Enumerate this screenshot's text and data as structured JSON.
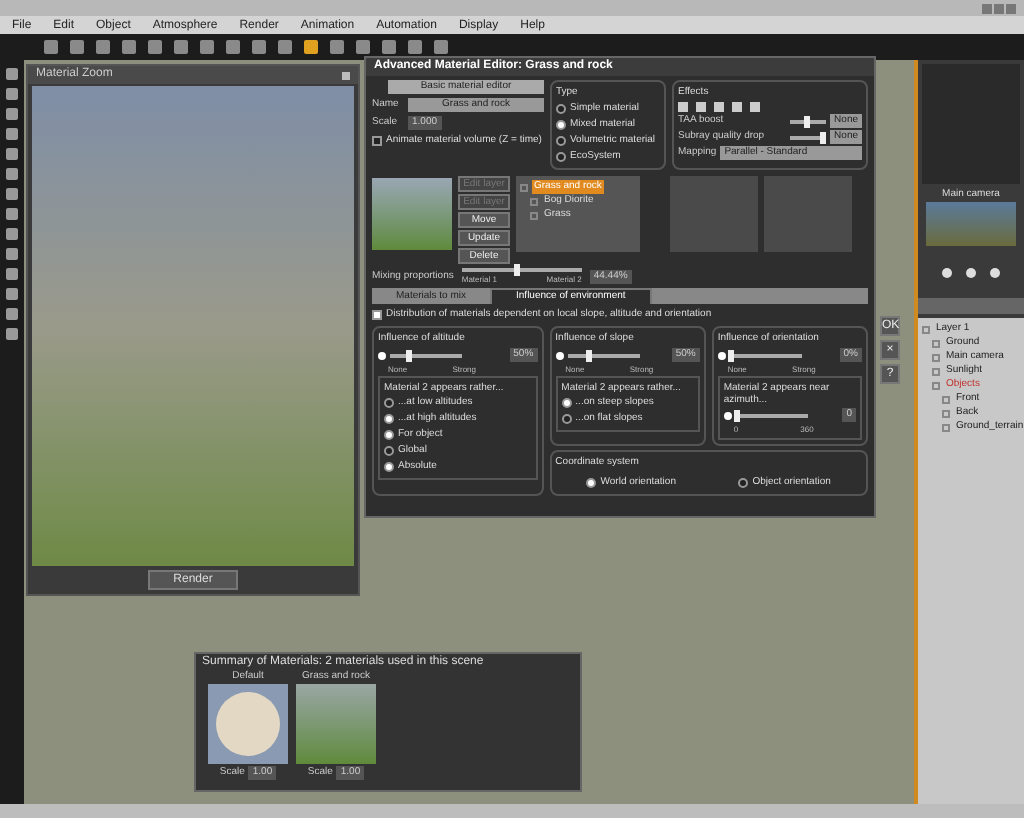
{
  "menu": [
    "File",
    "Edit",
    "Object",
    "Atmosphere",
    "Render",
    "Animation",
    "Automation",
    "Display",
    "Help"
  ],
  "material_zoom": {
    "title": "Material Zoom",
    "render_button": "Render"
  },
  "editor": {
    "title": "Advanced Material Editor: Grass and rock",
    "basic_button": "Basic material editor",
    "name_label": "Name",
    "name": "Grass and rock",
    "scale_label": "Scale",
    "scale": "1.000",
    "animate": {
      "label": "Animate material volume (Z = time)",
      "checked": false
    },
    "type": {
      "title": "Type",
      "options": [
        {
          "label": "Simple material",
          "selected": false
        },
        {
          "label": "Mixed material",
          "selected": true
        },
        {
          "label": "Volumetric material",
          "selected": false
        },
        {
          "label": "EcoSystem",
          "selected": false
        }
      ]
    },
    "effects": {
      "title": "Effects",
      "rows": [
        {
          "label": "TAA boost",
          "level": 0.45,
          "button": "None"
        },
        {
          "label": "Subray quality drop",
          "level": 0.9,
          "button": "None"
        }
      ],
      "mapping_label": "Mapping",
      "mapping": "Parallel - Standard"
    },
    "layer_buttons": [
      {
        "label": "Edit layer",
        "disabled": true
      },
      {
        "label": "Edit layer",
        "disabled": true
      },
      {
        "label": "Move",
        "disabled": false
      },
      {
        "label": "Update",
        "disabled": false
      },
      {
        "label": "Delete",
        "disabled": false
      }
    ],
    "layers": [
      {
        "label": "Grass and rock",
        "selected": true,
        "children": [
          {
            "label": "Bog Diorite",
            "selected": false
          },
          {
            "label": "Grass",
            "selected": false
          }
        ]
      }
    ],
    "mixing": {
      "label": "Mixing proportions",
      "level": 0.45,
      "left": "Material 1",
      "right": "Material 2",
      "value": "44.44%"
    },
    "tabs": [
      {
        "label": "Materials to mix",
        "selected": false
      },
      {
        "label": "Influence of environment",
        "selected": true
      }
    ],
    "distribution": {
      "label": "Distribution of materials dependent on local slope, altitude and orientation",
      "checked": true
    },
    "altitude": {
      "title": "Influence of altitude",
      "level": 0.25,
      "low": "None",
      "high": "Strong",
      "value": "50%",
      "sub_title": "Material 2 appears rather...",
      "options": [
        {
          "label": "...at low altitudes",
          "selected": false
        },
        {
          "label": "...at high altitudes",
          "selected": true
        },
        {
          "label": "For object",
          "selected": true
        },
        {
          "label": "Global",
          "selected": false
        },
        {
          "label": "Absolute",
          "selected": true
        }
      ]
    },
    "slope": {
      "title": "Influence of slope",
      "level": 0.3,
      "low": "None",
      "high": "Strong",
      "value": "50%",
      "sub_title": "Material 2 appears rather...",
      "options": [
        {
          "label": "...on steep slopes",
          "selected": true
        },
        {
          "label": "...on flat slopes",
          "selected": false
        }
      ]
    },
    "orientation": {
      "title": "Influence of orientation",
      "level": 0.0,
      "low": "None",
      "high": "Strong",
      "value": "0%",
      "sub_title": "Material 2 appears near azimuth...",
      "azimuth": {
        "level": 0.0,
        "min": "0",
        "max": "360",
        "value": "0"
      }
    },
    "coordinates": {
      "title": "Coordinate system",
      "options": [
        {
          "label": "World orientation",
          "selected": true
        },
        {
          "label": "Object orientation",
          "selected": false
        }
      ]
    },
    "side_buttons": [
      "OK",
      "×",
      "?"
    ]
  },
  "right_panel": {
    "camera_title": "Main camera",
    "layers": [
      {
        "label": "Layer 1",
        "selected": false,
        "children": [
          {
            "label": "Ground",
            "selected": false
          },
          {
            "label": "Main camera",
            "selected": false
          },
          {
            "label": "Sunlight",
            "selected": false
          },
          {
            "label": "Objects",
            "selected": true,
            "children": [
              {
                "label": "Front",
                "selected": false
              },
              {
                "label": "Back",
                "selected": false
              },
              {
                "label": "Ground_terrain",
                "selected": false
              }
            ]
          }
        ]
      }
    ]
  },
  "summary": {
    "title": "Summary of Materials: 2 materials used in this scene",
    "materials": [
      {
        "name": "Default",
        "kind": "sphere",
        "scale_label": "Scale",
        "scale": "1.00"
      },
      {
        "name": "Grass and rock",
        "kind": "terrain",
        "scale_label": "Scale",
        "scale": "1.00"
      }
    ]
  }
}
